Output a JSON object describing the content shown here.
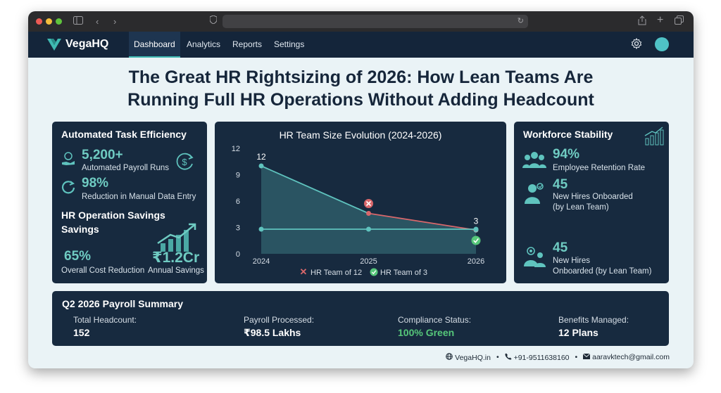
{
  "brand": {
    "name": "VegaHQ",
    "accent": "#3fb9b2"
  },
  "nav": {
    "items": [
      {
        "label": "Dashboard",
        "active": true
      },
      {
        "label": "Analytics"
      },
      {
        "label": "Reports"
      },
      {
        "label": "Settings"
      }
    ]
  },
  "headline": {
    "line1": "The Great HR Rightsizing of 2026: How Lean Teams Are",
    "line2": "Running Full HR Operations Without Adding Headcount"
  },
  "efficiency": {
    "title": "Automated Task Efficiency",
    "payroll_value": "5,200+",
    "payroll_label": "Automated Payroll Runs",
    "reduction_value": "98%",
    "reduction_label": "Reduction in Manual Data Entry",
    "savings_title_1": "HR Operation Savings",
    "savings_title_2": "Savings",
    "cost_value": "65%",
    "cost_label": "Overall Cost Reduction",
    "annual_value": "₹1.2Cr",
    "annual_label": "Annual Savings"
  },
  "chart_data": {
    "type": "line",
    "title": "HR Team Size Evolution (2024-2026)",
    "categories": [
      "2024",
      "2025",
      "2026"
    ],
    "ylim": [
      0,
      12
    ],
    "yticks": [
      0,
      3,
      6,
      9,
      12
    ],
    "grid": false,
    "legend": "bottom",
    "series": [
      {
        "name": "HR Team of 12",
        "values": [
          10,
          4.6,
          2.7
        ],
        "color": "#5fc3be",
        "fill": true
      },
      {
        "name": "HR Team of 3",
        "values": [
          2.8,
          2.8,
          2.8
        ],
        "color": "#5fc3be"
      }
    ],
    "trend_after_2025_color": "#d9676b",
    "annotations": [
      {
        "x": "2024",
        "text": "12"
      },
      {
        "x": "2026",
        "text": "3"
      }
    ]
  },
  "stability": {
    "title": "Workforce Stability",
    "retention_value": "94%",
    "retention_label": "Employee Retention Rate",
    "hires_value": "45",
    "hires_label_1": "New Hires Onboarded",
    "hires_label_2": "(by Lean Team)",
    "hires2_value": "45",
    "hires2_label_1": "New Hires",
    "hires2_label_2": "Onboarded (by Lean Team)"
  },
  "payroll": {
    "title": "Q2 2026 Payroll Summary",
    "headcount_label": "Total Headcount:",
    "headcount_value": "152",
    "processed_label": "Payroll Processed:",
    "processed_value": "₹98.5 Lakhs",
    "compliance_label": "Compliance Status:",
    "compliance_value": "100% Green",
    "compliance_color": "#56c77a",
    "benefits_label": "Benefits Managed:",
    "benefits_value": "12 Plans"
  },
  "footer": {
    "site": "VegaHQ.in",
    "phone": "+91-9511638160",
    "email": "aaravktech@gmail.com"
  }
}
